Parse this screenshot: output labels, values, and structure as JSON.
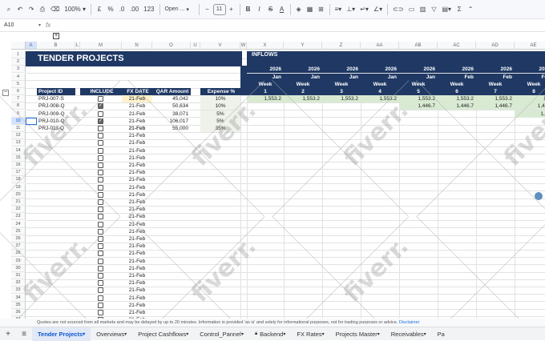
{
  "toolbar": {
    "zoom": "100%",
    "currency": "£",
    "percent": "%",
    "decimals_dec": ".0",
    "decimals_inc": ".00",
    "number_format": "123",
    "font": "Open ...",
    "font_size": "11",
    "minus": "−",
    "plus": "+",
    "bold": "B",
    "italic": "I",
    "strike": "S",
    "text_color": "A"
  },
  "formula_bar": {
    "name_box": "A10",
    "fx": "fx"
  },
  "columns": [
    "A",
    "B",
    "L",
    "M",
    "N",
    "O",
    "U",
    "V",
    "W",
    "X",
    "Y",
    "Z",
    "AA",
    "AB",
    "AC",
    "AD",
    "AE"
  ],
  "rows": [
    "1",
    "2",
    "3",
    "4",
    "5",
    "6",
    "7",
    "8",
    "9",
    "10",
    "11",
    "12",
    "13",
    "14",
    "15",
    "16",
    "17",
    "18",
    "19",
    "20",
    "21",
    "22",
    "23",
    "24",
    "25",
    "26",
    "27",
    "28",
    "29",
    "30",
    "31",
    "32",
    "33",
    "34",
    "35",
    "36",
    "37"
  ],
  "sheet": {
    "title": "TENDER PROJECTS",
    "inflows_label": "INFLOWS",
    "headers": {
      "project_id": "Project ID",
      "include": "INCLUDE",
      "fx_date": "FX DATE",
      "qar_amount": "QAR Amount",
      "expense": "Expense %"
    },
    "projects": [
      {
        "id": "PRJ-007-S",
        "include": false,
        "fx_date": "21-Feb",
        "qar": "45,042",
        "expense": "10%"
      },
      {
        "id": "PRJ-008-Q",
        "include": true,
        "fx_date": "21-Feb",
        "qar": "50,634",
        "expense": "10%"
      },
      {
        "id": "PRJ-009-Q",
        "include": false,
        "fx_date": "21-Feb",
        "qar": "38,071",
        "expense": "5%"
      },
      {
        "id": "PRJ-010-Q",
        "include": true,
        "fx_date": "21-Feb",
        "qar": "106,017",
        "expense": "5%"
      },
      {
        "id": "PRJ-011-Q",
        "include": true,
        "fx_date": "21-Feb",
        "qar": "55,000",
        "expense": "35%"
      }
    ],
    "empty_fx_date": "21-Feb",
    "timeline": [
      {
        "year": "2026",
        "month": "Jan",
        "week_label": "Week",
        "week": "1"
      },
      {
        "year": "2026",
        "month": "Jan",
        "week_label": "Week",
        "week": "2"
      },
      {
        "year": "2026",
        "month": "Jan",
        "week_label": "Week",
        "week": "3"
      },
      {
        "year": "2026",
        "month": "Jan",
        "week_label": "Week",
        "week": "4"
      },
      {
        "year": "2026",
        "month": "Jan",
        "week_label": "Week",
        "week": "5"
      },
      {
        "year": "2026",
        "month": "Feb",
        "week_label": "Week",
        "week": "6"
      },
      {
        "year": "2026",
        "month": "Feb",
        "week_label": "Week",
        "week": "7"
      },
      {
        "year": "2026",
        "month": "Feb",
        "week_label": "Week",
        "week": "8"
      }
    ],
    "inflow_rows": [
      [
        "1,553.2",
        "1,553.2",
        "1,553.2",
        "1,553.2",
        "1,553.2",
        "1,553.2",
        "1,553.2",
        "1,5"
      ],
      [
        "",
        "",
        "",
        "",
        "1,446.7",
        "1,446.7",
        "1,446.7",
        "1,446"
      ],
      [
        "",
        "",
        "",
        "",
        "",
        "",
        "",
        "1,35"
      ]
    ]
  },
  "watermark": "fiverr.",
  "disclaimer": {
    "text": "Quotes are not sourced from all markets and may be delayed by up to 20 minutes. Information is provided 'as is' and solely for informational purposes, not for trading purposes or advice.",
    "link": "Disclaimer"
  },
  "tabs": [
    "Tender Projects",
    "Overviews",
    "Project Cashflows",
    "Control_Pannel",
    "Backend",
    "FX Rates",
    "Projects Master",
    "Receivables",
    "Pa"
  ],
  "colors": {
    "navy": "#1f3864",
    "green_fill": "#d9ead3",
    "yellow_fill": "#fff2cc",
    "selection": "#d3e3fd"
  }
}
